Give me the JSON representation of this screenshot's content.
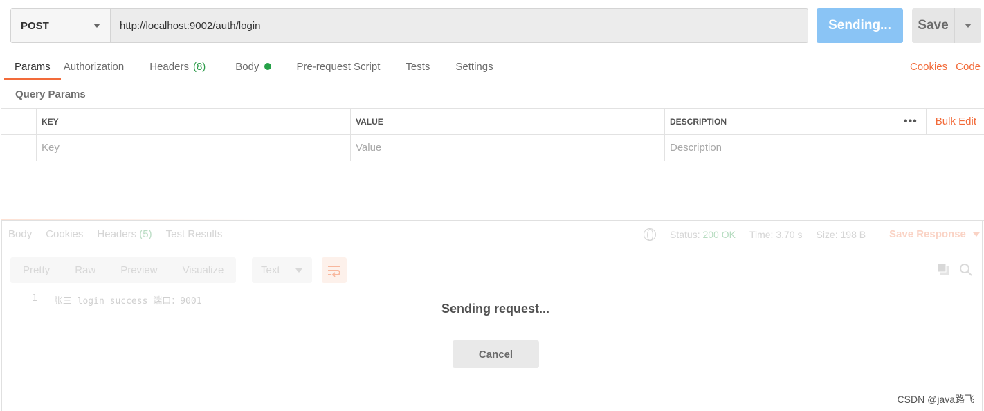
{
  "request": {
    "method": "POST",
    "url": "http://localhost:9002/auth/login",
    "send_label": "Sending...",
    "save_label": "Save"
  },
  "tabs": [
    {
      "label": "Params"
    },
    {
      "label": "Authorization"
    },
    {
      "label": "Headers",
      "count": "(8)"
    },
    {
      "label": "Body"
    },
    {
      "label": "Pre-request Script"
    },
    {
      "label": "Tests"
    },
    {
      "label": "Settings"
    }
  ],
  "tab_links": {
    "cookies": "Cookies",
    "code": "Code"
  },
  "query_params": {
    "title": "Query Params",
    "columns": {
      "key": "KEY",
      "value": "VALUE",
      "description": "DESCRIPTION"
    },
    "more": "•••",
    "bulk_edit": "Bulk Edit",
    "placeholders": {
      "key": "Key",
      "value": "Value",
      "description": "Description"
    }
  },
  "response": {
    "tabs": [
      {
        "label": "Body"
      },
      {
        "label": "Cookies"
      },
      {
        "label": "Headers",
        "count": "(5)"
      },
      {
        "label": "Test Results"
      }
    ],
    "status_label": "Status:",
    "status_value": "200 OK",
    "time_label": "Time:",
    "time_value": "3.70 s",
    "size_label": "Size:",
    "size_value": "198 B",
    "save_response": "Save Response",
    "formats": [
      "Pretty",
      "Raw",
      "Preview",
      "Visualize"
    ],
    "format_select": "Text",
    "line_number": "1",
    "line_text": "张三 login success 端口：9001"
  },
  "overlay": {
    "message": "Sending request...",
    "cancel": "Cancel"
  },
  "watermark": "CSDN @java路飞",
  "colors": {
    "accent": "#f26b3a",
    "send": "#8ac4f5",
    "success": "#26a148"
  }
}
